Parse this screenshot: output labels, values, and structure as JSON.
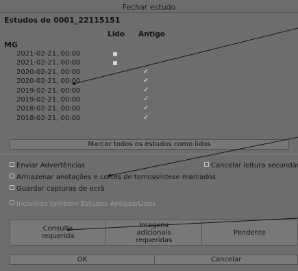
{
  "dialog": {
    "title": "Fechar estudo"
  },
  "studies": {
    "heading": "Estudos de 0001_22115151",
    "col_lido": "Lido",
    "col_antigo": "Antigo",
    "group": "MG",
    "rows": [
      {
        "date": "2021-02-21, 00:00",
        "lido_box": true,
        "antigo": ""
      },
      {
        "date": "2021-02-21, 00:00",
        "lido_box": true,
        "antigo": ""
      },
      {
        "date": "2020-02-21, 00:00",
        "lido_box": false,
        "antigo": "✓"
      },
      {
        "date": "2020-02-21, 00:00",
        "lido_box": false,
        "antigo": "✓"
      },
      {
        "date": "2019-02-21, 00:00",
        "lido_box": false,
        "antigo": "✓"
      },
      {
        "date": "2019-02-21, 00:00",
        "lido_box": false,
        "antigo": "✓"
      },
      {
        "date": "2018-02-21, 00:00",
        "lido_box": false,
        "antigo": "✓"
      },
      {
        "date": "2018-02-21, 00:00",
        "lido_box": false,
        "antigo": "✓"
      }
    ]
  },
  "mark_all_button": "Marcar todos os estudos como lidos",
  "options": {
    "send_warnings": "Enviar Advertências",
    "cancel_secondary": "Cancelar leitura secundária",
    "store_annotations": "Armazenar anotações e cortes de tomossíntese marcados",
    "save_screenshots": "Guardar capturas de ecrã",
    "include_old": "Incluindo também Estudos Antigos/Lidos"
  },
  "buttons": {
    "consult_l1": "Consulta",
    "consult_l2": "requerida",
    "images_l1": "Imagens",
    "images_l2": "adicionais",
    "images_l3": "requeridas",
    "pending": "Pendente",
    "ok": "OK",
    "cancel": "Cancelar"
  }
}
